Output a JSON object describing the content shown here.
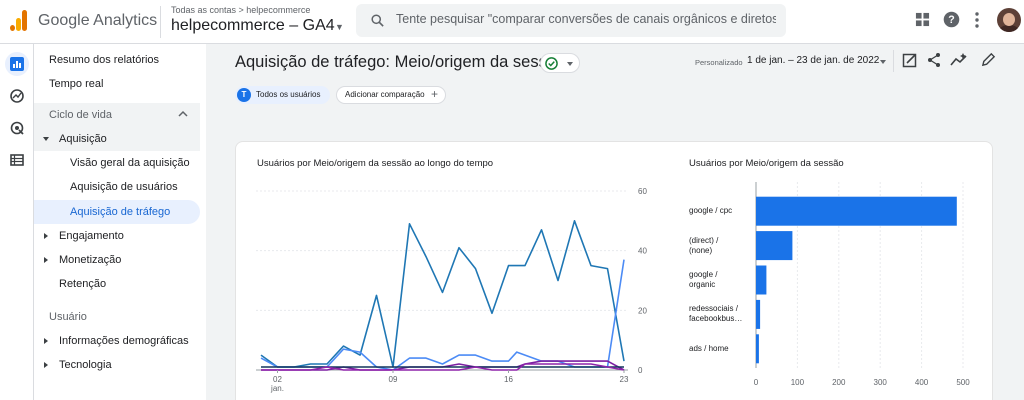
{
  "app": {
    "product_name": "Google Analytics",
    "breadcrumb": "Todas as contas > helpecommerce",
    "property_name": "helpecommerce – GA4"
  },
  "search": {
    "placeholder": "Tente pesquisar \"comparar conversões de canais orgânicos e diretos\""
  },
  "topbar_icons": [
    "apps-grid-icon",
    "help-icon",
    "more-vert-icon",
    "avatar"
  ],
  "rail_icons": [
    "reports-icon",
    "explore-icon",
    "advertising-icon",
    "configure-icon"
  ],
  "nav": {
    "summary": "Resumo dos relatórios",
    "realtime": "Tempo real",
    "lifecycle": "Ciclo de vida",
    "acquisition": "Aquisição",
    "acquisition_overview": "Visão geral da aquisição",
    "user_acquisition": "Aquisição de usuários",
    "traffic_acquisition": "Aquisição de tráfego",
    "engagement": "Engajamento",
    "monetization": "Monetização",
    "retention": "Retenção",
    "user_section": "Usuário",
    "demographics": "Informações demográficas",
    "tech": "Tecnologia"
  },
  "header": {
    "title": "Aquisição de tráfego: Meio/origem da sessão",
    "custom_label": "Personalizado",
    "date_range": "1 de jan. – 23 de jan. de 2022"
  },
  "chips": {
    "badge": "T",
    "all_users": "Todos os usuários",
    "add_comparison": "Adicionar comparação"
  },
  "colors": {
    "accent": "#1a73e8",
    "series": [
      "#1f77b4",
      "#4c8bf5",
      "#7b1fa2",
      "#12355b",
      "#8e24aa"
    ]
  },
  "chart_data": [
    {
      "type": "line",
      "title": "Usuários por Meio/origem da sessão ao longo do tempo",
      "x_ticks": [
        "02",
        "09",
        "16",
        "23"
      ],
      "x_tick_days": [
        2,
        9,
        16,
        23
      ],
      "x_sublabel": "jan.",
      "ylim": [
        0,
        60
      ],
      "y_ticks": [
        0,
        20,
        40,
        60
      ],
      "x": [
        1,
        2,
        3,
        4,
        5,
        6,
        7,
        8,
        9,
        10,
        11,
        12,
        13,
        14,
        15,
        16,
        16.5,
        17,
        18,
        19,
        20,
        21,
        22,
        23
      ],
      "series": [
        {
          "color": "#1f77b4",
          "values": [
            5,
            1,
            1,
            2,
            2,
            8,
            5,
            25,
            1,
            49,
            38,
            26,
            41,
            34,
            19,
            35,
            35,
            35,
            47,
            30,
            50,
            35,
            34,
            3
          ]
        },
        {
          "color": "#4c8bf5",
          "values": [
            4,
            1,
            1,
            1,
            1,
            7,
            6,
            1,
            0,
            4,
            4,
            2,
            5,
            5,
            3,
            3,
            6,
            5,
            3,
            3,
            1,
            1,
            1,
            37
          ]
        },
        {
          "color": "#7b1fa2",
          "values": [
            0,
            0,
            0,
            0,
            0,
            1,
            0,
            0,
            0,
            1,
            1,
            1,
            2,
            1,
            1,
            1,
            1,
            2,
            3,
            3,
            3,
            3,
            3,
            0
          ]
        },
        {
          "color": "#12355b",
          "values": [
            1,
            1,
            1,
            1,
            1,
            1,
            1,
            1,
            1,
            1,
            1,
            1,
            1,
            1,
            1,
            1,
            1,
            1,
            1,
            1,
            1,
            1,
            1,
            1
          ]
        },
        {
          "color": "#8e24aa",
          "values": [
            0,
            0,
            0,
            0,
            1,
            0,
            0,
            0,
            0,
            0,
            0,
            0,
            0,
            1,
            0,
            0,
            0,
            2,
            2,
            2,
            2,
            2,
            1,
            0
          ]
        }
      ]
    },
    {
      "type": "bar",
      "orientation": "horizontal",
      "title": "Usuários por Meio/origem da sessão",
      "categories": [
        "google / cpc",
        "(direct) / (none)",
        "google / organic",
        "redessociais / facebookbus…",
        "ads / home"
      ],
      "category_lines": [
        [
          "google / cpc"
        ],
        [
          "(direct) /",
          "(none)"
        ],
        [
          "google /",
          "organic"
        ],
        [
          "redessociais /",
          "facebookbus…"
        ],
        [
          "ads / home"
        ]
      ],
      "values": [
        485,
        88,
        25,
        10,
        7
      ],
      "xlim": [
        0,
        500
      ],
      "x_ticks": [
        0,
        100,
        200,
        300,
        400,
        500
      ],
      "color": "#1a73e8"
    }
  ]
}
